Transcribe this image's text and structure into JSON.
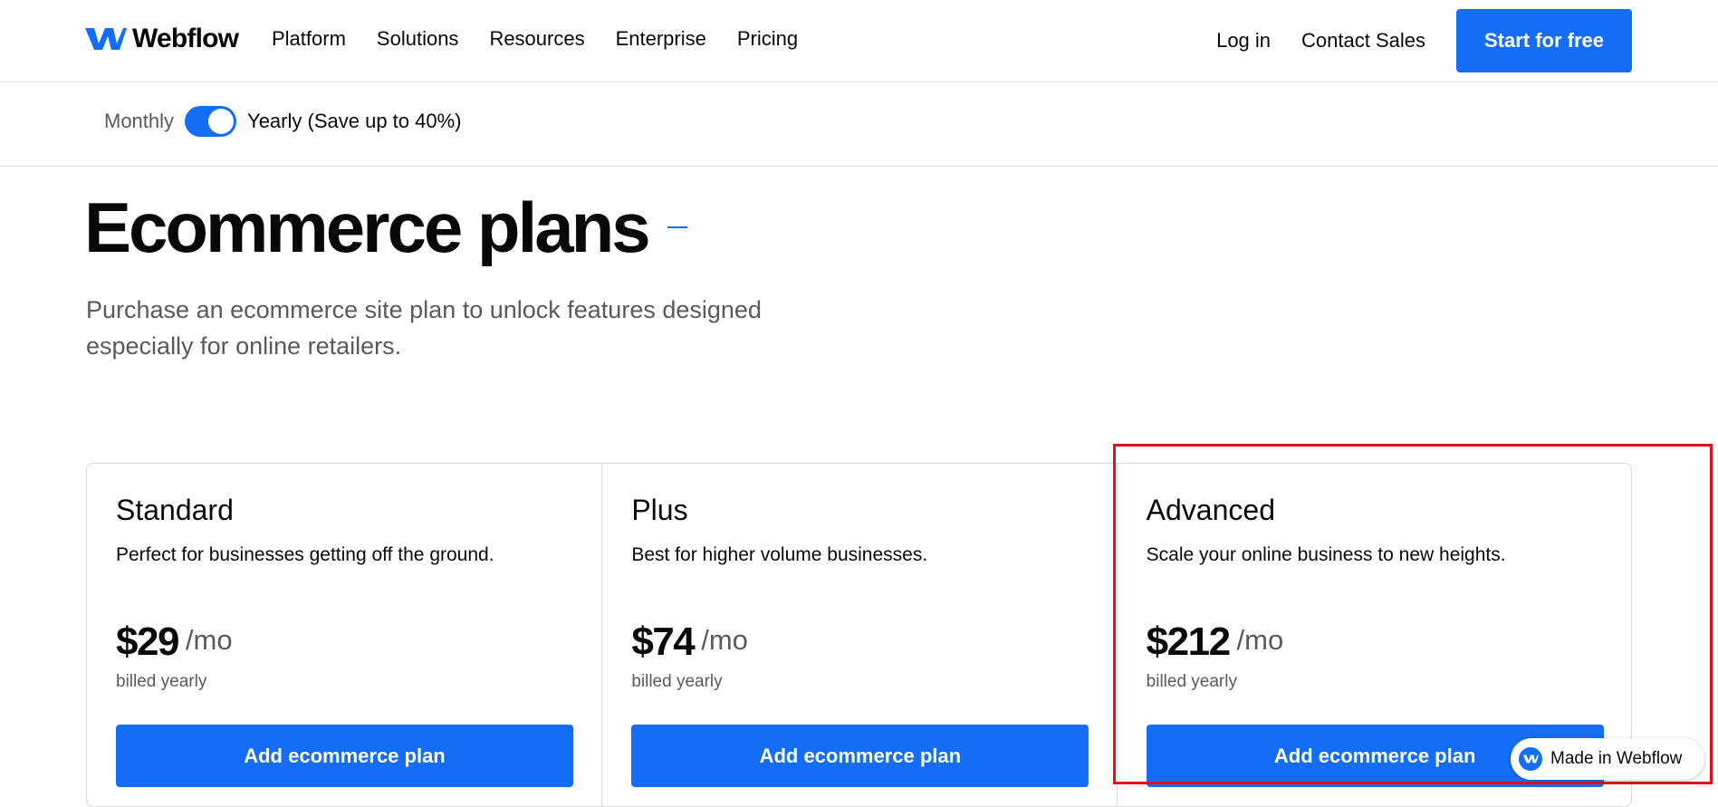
{
  "nav": {
    "brand": "Webflow",
    "links": [
      "Platform",
      "Solutions",
      "Resources",
      "Enterprise",
      "Pricing"
    ],
    "login": "Log in",
    "contact": "Contact Sales",
    "cta": "Start for free"
  },
  "billing": {
    "monthly_label": "Monthly",
    "yearly_label": "Yearly (Save up to 40%)",
    "selected": "yearly"
  },
  "hero": {
    "title": "Ecommerce plans",
    "subtitle": "Purchase an ecommerce site plan to unlock features designed especially for online retailers."
  },
  "plans": [
    {
      "name": "Standard",
      "desc": "Perfect for businesses getting off the ground.",
      "price": "$29",
      "per": "/mo",
      "billed": "billed yearly",
      "cta": "Add ecommerce plan"
    },
    {
      "name": "Plus",
      "desc": "Best for higher volume businesses.",
      "price": "$74",
      "per": "/mo",
      "billed": "billed yearly",
      "cta": "Add ecommerce plan"
    },
    {
      "name": "Advanced",
      "desc": "Scale your online business to new heights.",
      "price": "$212",
      "per": "/mo",
      "billed": "billed yearly",
      "cta": "Add ecommerce plan"
    }
  ],
  "badge": {
    "label": "Made in Webflow"
  },
  "colors": {
    "accent": "#146ef5",
    "highlight": "#e3101a",
    "text": "#080808",
    "muted": "#5a5a5a"
  }
}
